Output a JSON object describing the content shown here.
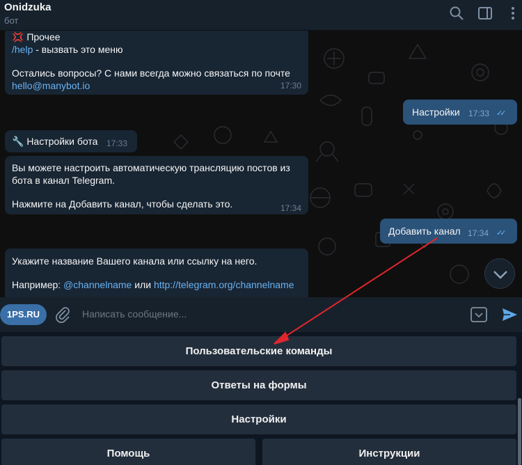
{
  "header": {
    "title": "Onidzuka",
    "subtitle": "бот"
  },
  "messages": {
    "m1": {
      "emoji": "💢",
      "line1": "Прочее",
      "help_cmd": "/help",
      "help_text": " - вызвать это меню",
      "line3": "Остались вопросы? С нами всегда можно связаться по почте",
      "email": "hello@manybot.io",
      "time": "17:30"
    },
    "m2": {
      "text": "Настройки",
      "time": "17:33"
    },
    "m3": {
      "text": "🔧 Настройки бота",
      "time": "17:33"
    },
    "m4": {
      "line1": "Вы можете настроить автоматическую трансляцию постов из",
      "line2": "бота в канал Telegram.",
      "line3": "Нажмите на Добавить канал, чтобы сделать это.",
      "time": "17:34"
    },
    "m5": {
      "text": "Добавить канал",
      "time": "17:34"
    },
    "m6": {
      "line1": "Укажите название Вашего канала или ссылку на него.",
      "example_prefix": "Например: ",
      "example_handle": "@channelname",
      "example_or": " или ",
      "example_url": "http://telegram.org/channelname"
    }
  },
  "input": {
    "badge": "1PS.RU",
    "placeholder": "Написать сообщение..."
  },
  "keyboard": {
    "buttons": [
      "Пользовательские команды",
      "Ответы на формы",
      "Настройки",
      "Помощь",
      "Инструкции"
    ]
  },
  "colors": {
    "accent": "#6ab3f3",
    "annotation_arrow": "#e0262c",
    "outgoing_bubble": "#2b5278",
    "incoming_bubble": "#182533"
  },
  "icons": [
    "search-icon",
    "sidebar-toggle-icon",
    "more-icon",
    "paperclip-icon",
    "bot-keyboard-icon",
    "send-icon",
    "chevron-down-icon"
  ]
}
